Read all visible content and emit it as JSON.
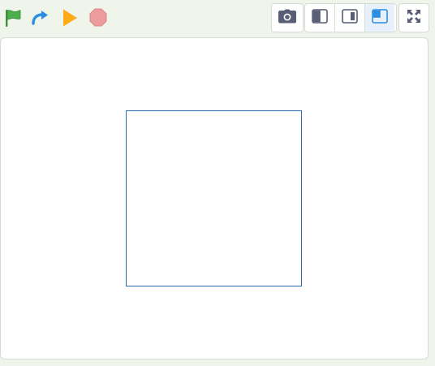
{
  "toolbar": {
    "left_controls": [
      {
        "icon": "green-flag-icon",
        "color": "#4cae4c"
      },
      {
        "icon": "redo-arrow-icon",
        "color": "#2c8ee0"
      },
      {
        "icon": "play-icon",
        "color": "#ffab19"
      },
      {
        "icon": "stop-icon",
        "color": "#ec9c9c"
      }
    ],
    "right_controls": [
      {
        "icon": "camera-icon"
      },
      {
        "icon": "small-stage-left-icon"
      },
      {
        "icon": "small-stage-right-icon"
      },
      {
        "icon": "stage-layout-active-icon",
        "active": true
      },
      {
        "icon": "fullscreen-icon"
      }
    ]
  },
  "stage": {
    "background": "#ffffff",
    "shape": {
      "type": "square",
      "stroke": "#2a6bb3"
    }
  }
}
